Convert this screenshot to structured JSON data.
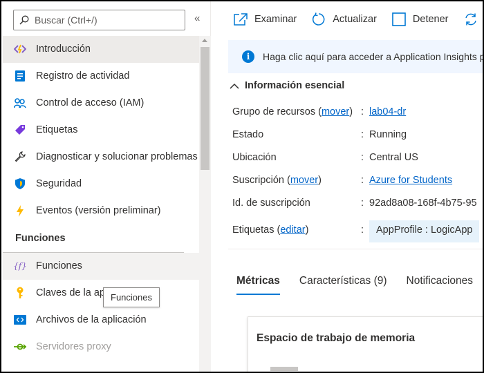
{
  "search": {
    "placeholder": "Buscar (Ctrl+/)"
  },
  "collapse_glyph": "«",
  "nav": {
    "items": [
      {
        "label": "Introducción",
        "icon": "introduccion-icon"
      },
      {
        "label": "Registro de actividad",
        "icon": "activity-log-icon"
      },
      {
        "label": "Control de acceso (IAM)",
        "icon": "iam-icon"
      },
      {
        "label": "Etiquetas",
        "icon": "tag-icon"
      },
      {
        "label": "Diagnosticar y solucionar problemas",
        "icon": "wrench-icon"
      },
      {
        "label": "Seguridad",
        "icon": "shield-icon"
      },
      {
        "label": "Eventos (versión preliminar)",
        "icon": "lightning-icon"
      }
    ],
    "section_title": "Funciones",
    "section_items": [
      {
        "label": "Funciones",
        "icon": "function-icon"
      },
      {
        "label": "Claves de la ap",
        "icon": "key-icon"
      },
      {
        "label": "Archivos de la aplicación",
        "icon": "app-files-icon"
      },
      {
        "label": "Servidores proxy",
        "icon": "proxy-icon"
      }
    ]
  },
  "tooltip": "Funciones",
  "toolbar": {
    "browse": "Examinar",
    "refresh": "Actualizar",
    "stop": "Detener",
    "restart": "R"
  },
  "banner": {
    "text": "Haga clic aquí para acceder a Application Insights p"
  },
  "essentials": {
    "title": "Información esencial"
  },
  "properties": {
    "resource_group_label": "Grupo de recursos",
    "resource_group_move": "mover",
    "resource_group_value": "lab04-dr",
    "status_label": "Estado",
    "status_value": "Running",
    "location_label": "Ubicación",
    "location_value": "Central US",
    "subscription_label": "Suscripción",
    "subscription_move": "mover",
    "subscription_value": "Azure for Students",
    "subscription_id_label": "Id. de suscripción",
    "subscription_id_value": "92ad8a08-168f-4b75-95",
    "tags_label": "Etiquetas",
    "tags_edit": "editar",
    "tags_value": "AppProfile : LogicApp"
  },
  "tabs": [
    {
      "label": "Métricas",
      "active": true
    },
    {
      "label": "Características (9)",
      "active": false
    },
    {
      "label": "Notificaciones",
      "active": false
    }
  ],
  "card": {
    "title": "Espacio de trabajo de memoria"
  },
  "colors": {
    "accent": "#0078d4",
    "link": "#0064c8",
    "selected_bg": "#edebe9",
    "banner_bg": "#f0f6ff"
  }
}
